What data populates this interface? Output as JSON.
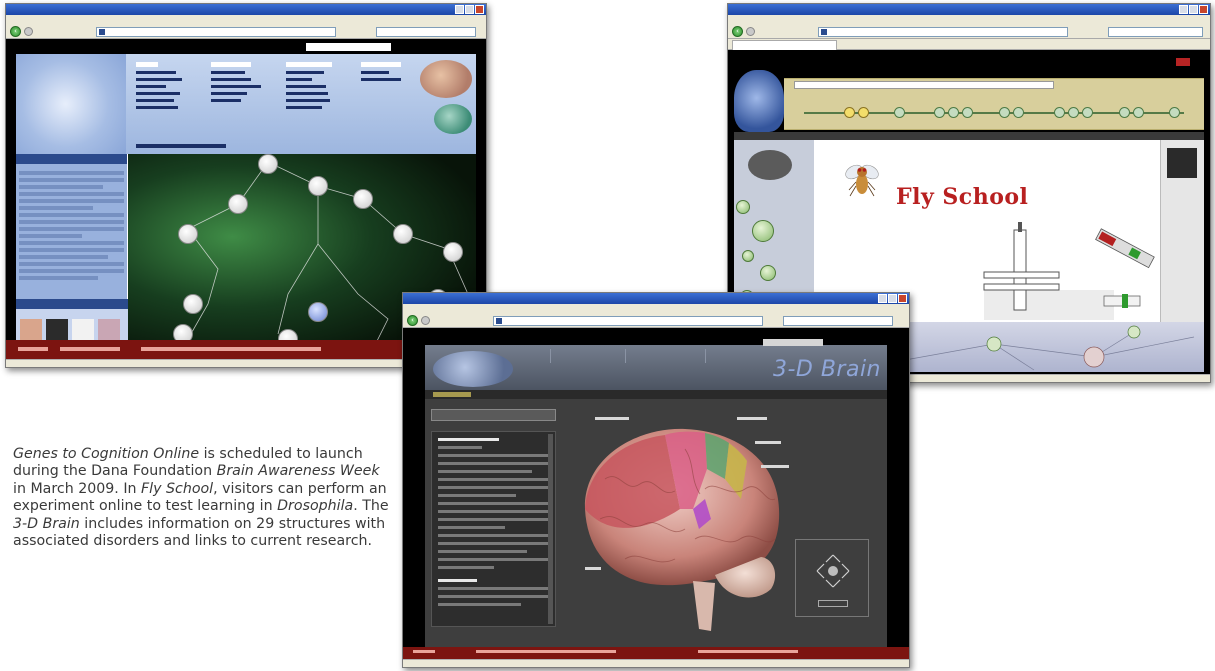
{
  "caption": {
    "part1_italic": "Genes to Cognition Online",
    "part2": " is scheduled to launch during the Dana Foundation ",
    "part3_italic": "Brain Awareness Week",
    "part4": " in March 2009. In ",
    "part5_italic": "Fly School",
    "part6": ", visitors can perform an experiment online to test learning in ",
    "part7_italic": "Drosophila",
    "part8": ". The ",
    "part9_italic": "3-D Brain",
    "part10": " includes information on 29 structures with associated disorders and links to current research."
  },
  "windows": {
    "fly_school": {
      "title_text": "Fly School"
    },
    "brain_3d": {
      "title_text": "3-D Brain"
    }
  },
  "colors": {
    "accent_red": "#7c1410",
    "fly_title_red": "#b82020",
    "g2c_blue": "#2b4a8c",
    "brain_title_blue": "#8fa6d9"
  }
}
